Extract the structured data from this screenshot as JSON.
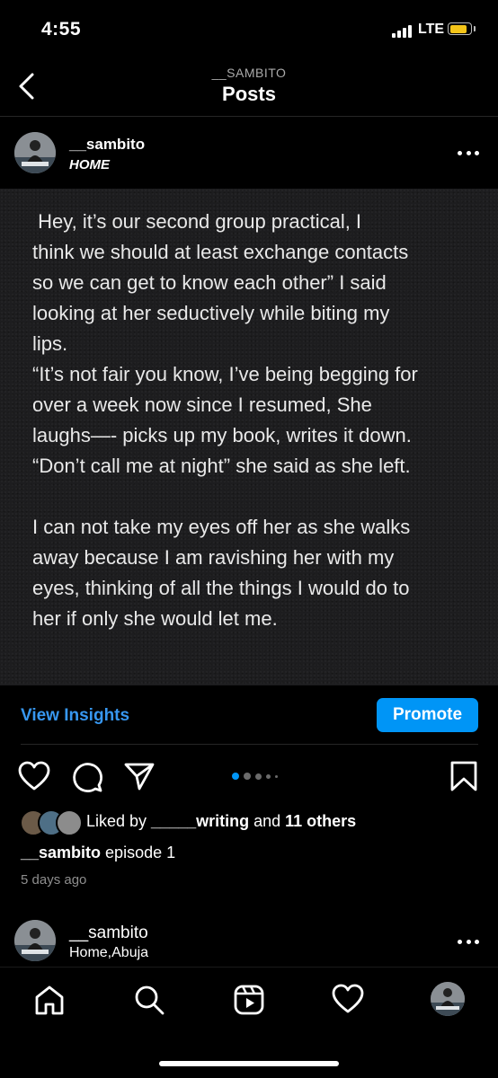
{
  "status_bar": {
    "time": "4:55",
    "network": "LTE",
    "battery_level": 0.85,
    "battery_color": "#f5c518"
  },
  "header": {
    "username": "__SAMBITO",
    "title": "Posts"
  },
  "post": {
    "username": "__sambito",
    "location": "HOME",
    "text": {
      "para1": " Hey, it’s our second group practical, I\nthink we should at least exchange contacts\nso we can get to know each other” I said\nlooking at her seductively while biting my\nlips.\n“It’s not fair you know, I’ve being begging for\nover a week now since I resumed, She\nlaughs—- picks up my book, writes it down.\n“Don’t call me at night” she said as she left.",
      "para2": "I can not take my eyes off her as she walks\naway because I am ravishing her with my\neyes, thinking of all the things I would do to\nher if only she would let me."
    },
    "insights_label": "View Insights",
    "promote_label": "Promote",
    "carousel": {
      "count": 5,
      "active_index": 0
    },
    "likes": {
      "prefix": "Liked by ",
      "liker": "_____writing",
      "joiner": " and ",
      "others": "11 others"
    },
    "caption": {
      "username": "__sambito",
      "text": " episode 1"
    },
    "time_ago": "5 days ago"
  },
  "next_post": {
    "username": "__sambito",
    "location": "Home,Abuja"
  },
  "tab_bar": {
    "items": [
      "home-icon",
      "search-icon",
      "reels-icon",
      "heart-icon",
      "profile-avatar"
    ]
  },
  "colors": {
    "link": "#3797f0",
    "promote": "#0095f6",
    "active_dot": "#0095f6",
    "muted": "#8e8e8e"
  }
}
